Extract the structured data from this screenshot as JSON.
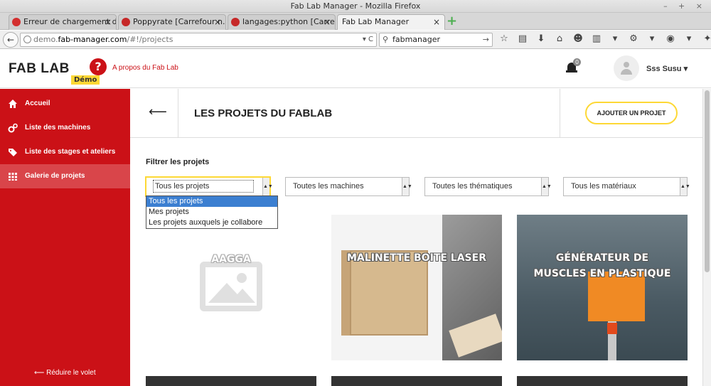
{
  "window": {
    "title": "Fab Lab Manager - Mozilla Firefox",
    "controls": "– + ×"
  },
  "tabs": [
    {
      "label": "Erreur de chargement d...",
      "icon_color": "#d32f2f"
    },
    {
      "label": "Poppyrate [Carrefour n...",
      "icon_color": "#c62828"
    },
    {
      "label": "langages:python [Carre...",
      "icon_color": "#c62828"
    },
    {
      "label": "Fab Lab Manager",
      "icon_color": ""
    }
  ],
  "tab_close": "×",
  "new_tab": "+",
  "navbar": {
    "back": "←",
    "url_prefix": "demo.",
    "url_host": "fab-manager.com",
    "url_path": "/#!/projects",
    "url_ctrl": "▾ C",
    "search_value": "fabmanager",
    "search_go": "→",
    "tool_icons": [
      "☆",
      "▤",
      "⬇",
      "⌂",
      "☻",
      "▥",
      "▾",
      "⚙",
      "▾",
      "◉",
      "▾",
      "✦",
      "≡"
    ]
  },
  "header": {
    "logo": "FAB LAB",
    "demo_badge": "Démo",
    "help_glyph": "?",
    "about": "A propos du Fab Lab",
    "notif_count": "0",
    "username": "Sss Susu ▾"
  },
  "sidebar": {
    "items": [
      {
        "label": "Accueil",
        "icon": "home-icon"
      },
      {
        "label": "Liste des machines",
        "icon": "gears-icon"
      },
      {
        "label": "Liste des stages et ateliers",
        "icon": "tag-icon"
      },
      {
        "label": "Galerie de projets",
        "icon": "grid-icon"
      }
    ],
    "collapse": "⟵ Réduire le volet"
  },
  "page": {
    "back": "⟵",
    "title": "LES PROJETS DU FABLAB",
    "add_button": "AJOUTER UN PROJET",
    "filter_label": "Filtrer les projets"
  },
  "filters": [
    {
      "value": "Tous les projets"
    },
    {
      "value": "Toutes les machines"
    },
    {
      "value": "Toutes les thématiques"
    },
    {
      "value": "Tous les matériaux"
    }
  ],
  "select_arrow": "▲▼",
  "dropdown_options": [
    "Tous les projets",
    "Mes projets",
    "Les projets auxquels je collabore"
  ],
  "projects": [
    {
      "title": "AAGGA"
    },
    {
      "title": "MALINETTE BOITE LASER"
    },
    {
      "title": "GÉNÉRATEUR DE MUSCLES EN PLASTIQUE"
    }
  ],
  "colors": {
    "brand_red": "#cb1117",
    "accent_yellow": "#fdd835",
    "selection_blue": "#3c7fd1"
  }
}
